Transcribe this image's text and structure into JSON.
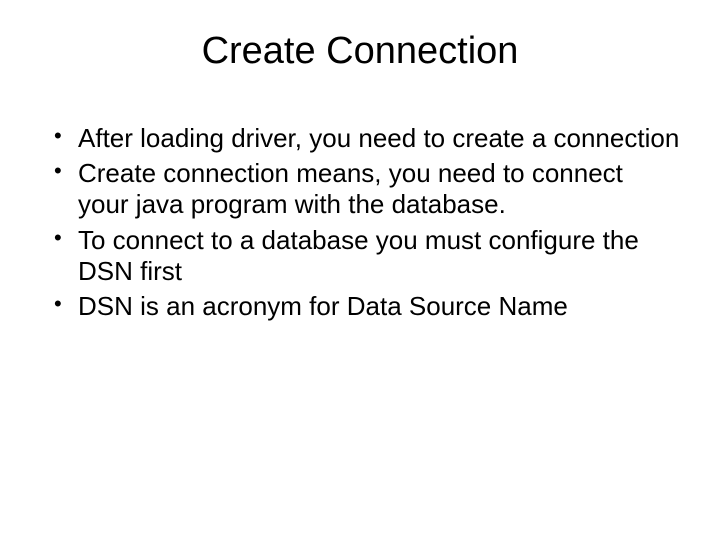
{
  "title": "Create Connection",
  "bullets": [
    "After loading driver, you need to create a connection",
    "Create connection means, you need to connect your java program with the database.",
    "To connect to a database you must configure the DSN first",
    "DSN is an acronym for Data Source Name"
  ]
}
